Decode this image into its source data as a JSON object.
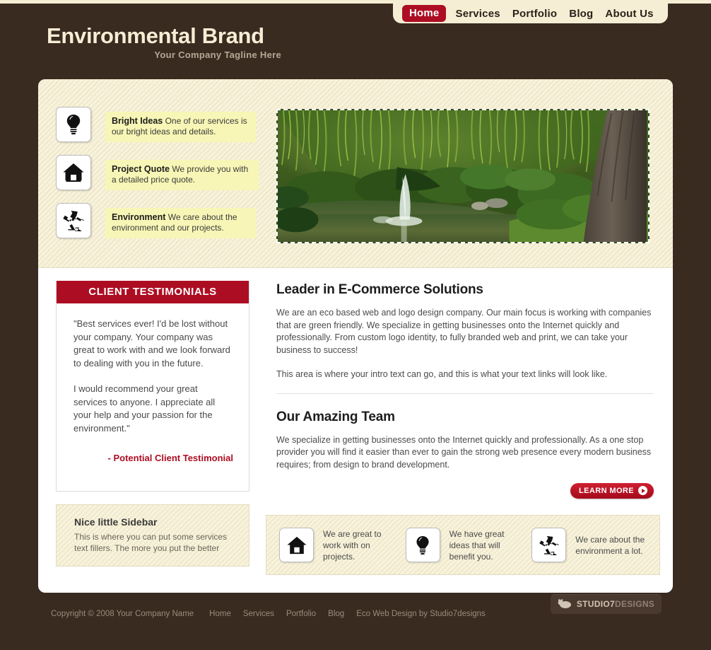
{
  "nav": {
    "items": [
      {
        "label": "Home",
        "active": true
      },
      {
        "label": "Services",
        "active": false
      },
      {
        "label": "Portfolio",
        "active": false
      },
      {
        "label": "Blog",
        "active": false
      },
      {
        "label": "About Us",
        "active": false
      }
    ]
  },
  "header": {
    "brand": "Environmental Brand",
    "tagline": "Your Company Tagline Here"
  },
  "features": [
    {
      "icon": "lightbulb-icon",
      "title": "Bright Ideas",
      "text": "One of our services is our bright ideas and details."
    },
    {
      "icon": "house-icon",
      "title": "Project Quote",
      "text": "We provide you with a detailed price quote."
    },
    {
      "icon": "recycle-icon",
      "title": "Environment",
      "text": "We care about the environment and our projects."
    }
  ],
  "banner": {
    "alt": "garden-pond-with-fountain-and-willow-trees"
  },
  "testimonials": {
    "heading": "CLIENT TESTIMONIALS",
    "quote1": "\"Best services ever! I'd be lost without your company. Your company was great to work with and we look forward to dealing with you in the future.",
    "quote2": "I would recommend your great services to anyone. I appreciate all your help and your passion for the environment.\"",
    "author": "- Potential Client Testimonial"
  },
  "sidebar_box": {
    "title": "Nice little Sidebar",
    "text": "This is where you can put some services text fillers. The more you put the better"
  },
  "main": {
    "section1": {
      "title": "Leader in E-Commerce Solutions",
      "paragraph1": "We are an eco based web and logo design company. Our main focus is working with companies that are green friendly. We specialize in getting businesses onto the Internet quickly and professionally. From custom logo identity, to fully branded web and print, we can take your business to success!",
      "paragraph2": "This area is where your intro text can go, and this is what your text links will look like."
    },
    "section2": {
      "title": "Our Amazing Team",
      "paragraph1": "We specialize in getting businesses onto the Internet quickly and professionally. As a one stop provider you will find it easier than ever to gain the strong web presence every modern business requires; from design to brand development.",
      "learn_more": "LEARN MORE"
    }
  },
  "promos": [
    {
      "icon": "house-icon",
      "text": "We are great to work with on projects."
    },
    {
      "icon": "lightbulb-icon",
      "text": "We have great ideas that will benefit you."
    },
    {
      "icon": "recycle-icon",
      "text": "We care about the environment a lot."
    }
  ],
  "footer": {
    "copyright": "Copyright © 2008 Your Company Name",
    "links": [
      "Home",
      "Services",
      "Portfolio",
      "Blog",
      "Eco Web Design by Studio7designs"
    ],
    "badge": {
      "icon": "bear-icon",
      "text_bold": "STUDIO7",
      "text_light": "DESIGNS"
    }
  },
  "colors": {
    "page_background": "#3a2b21",
    "cream": "#f6eed4",
    "accent_red": "#ad0d22",
    "feature_yellow": "#f7f6b6",
    "card_white": "#ffffff"
  }
}
